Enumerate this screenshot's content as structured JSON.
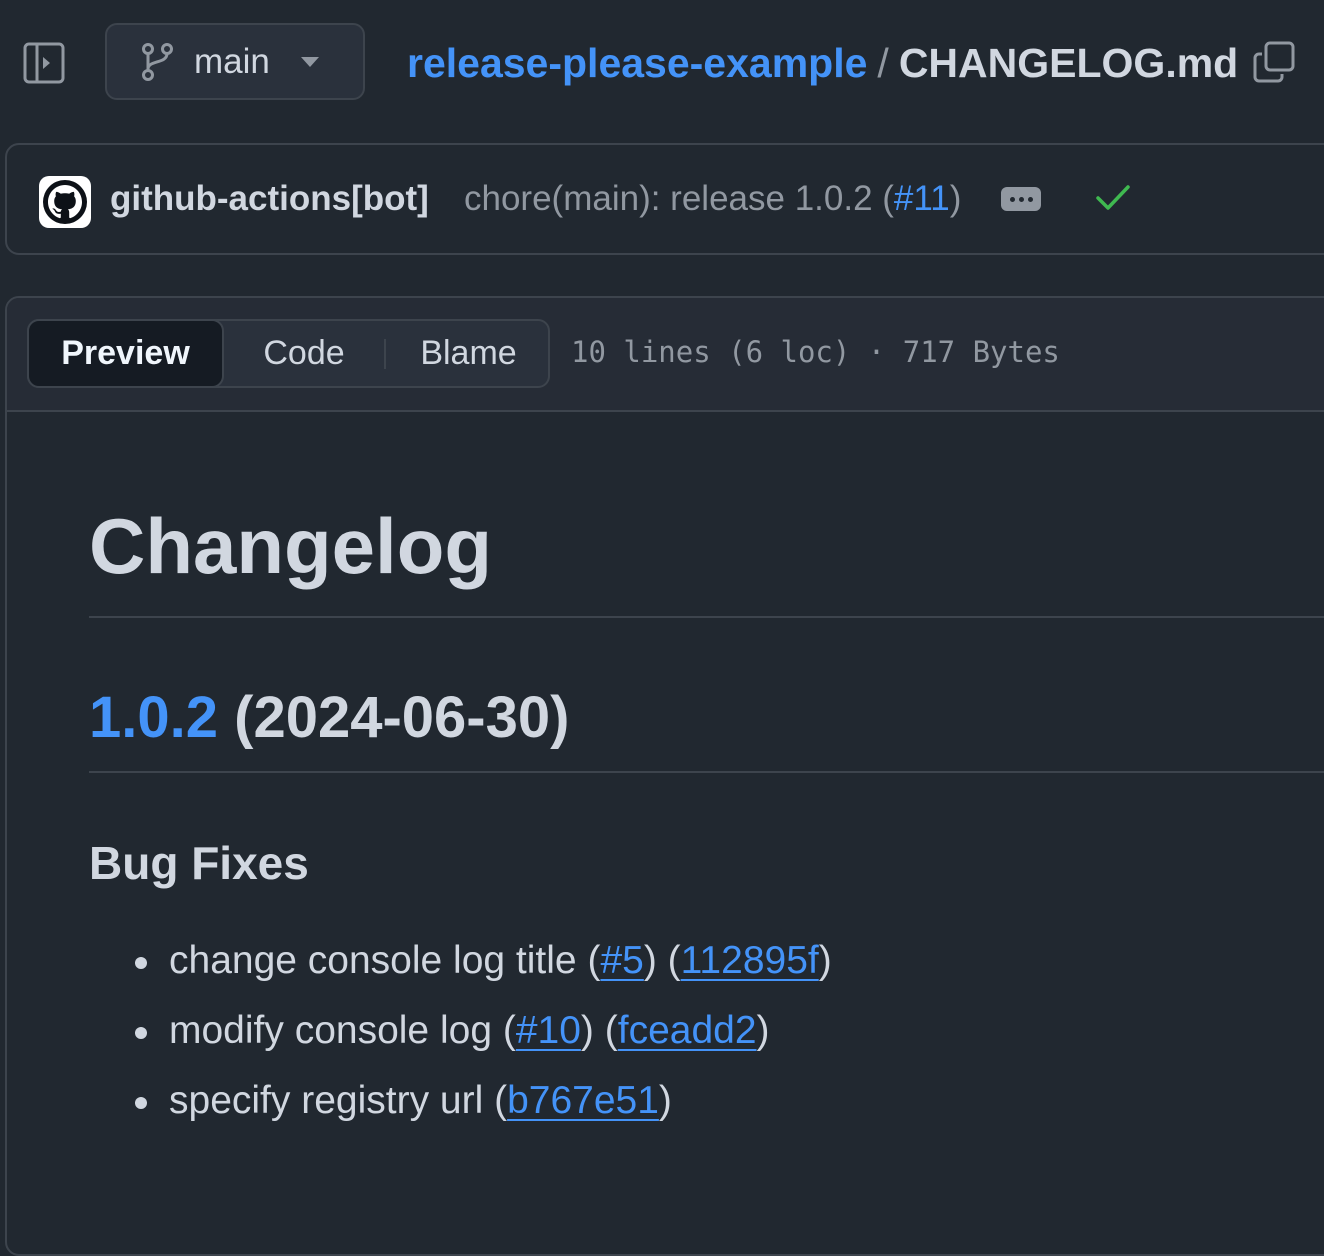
{
  "header": {
    "sidebar_toggle_icon": "sidebar-expand-icon",
    "branch": {
      "icon": "git-branch-icon",
      "name": "main",
      "caret_icon": "triangle-down-icon"
    },
    "breadcrumb": {
      "repo": "release-please-example",
      "separator": "/",
      "file": "CHANGELOG.md"
    },
    "copy_icon": "copy-icon"
  },
  "commit": {
    "avatar_icon": "github-mark-icon",
    "author": "github-actions[bot]",
    "message_prefix": "chore(main): release 1.0.2 (",
    "pr_link": "#11",
    "message_suffix": ")",
    "more_icon": "ellipsis-icon",
    "status_icon": "check-icon",
    "status_color": "#3fb950"
  },
  "file_header": {
    "tabs": [
      {
        "label": "Preview",
        "selected": true
      },
      {
        "label": "Code",
        "selected": false
      },
      {
        "label": "Blame",
        "selected": false
      }
    ],
    "info": "10 lines (6 loc) · 717 Bytes"
  },
  "markdown": {
    "h1": "Changelog",
    "h2": {
      "version": "1.0.2",
      "date": "(2024-06-30)"
    },
    "h3": "Bug Fixes",
    "items": [
      {
        "text": "change console log title (",
        "link1": "#5",
        "mid": ") (",
        "link2": "112895f",
        "end": ")"
      },
      {
        "text": "modify console log (",
        "link1": "#10",
        "mid": ") (",
        "link2": "fceadd2",
        "end": ")"
      },
      {
        "text": "specify registry url (",
        "link1": "b767e51",
        "end": ")"
      }
    ]
  },
  "colors": {
    "background": "#212830",
    "link": "#4493f8",
    "border": "#3d444d",
    "text": "#d1d7e0",
    "muted": "#9198a1"
  }
}
